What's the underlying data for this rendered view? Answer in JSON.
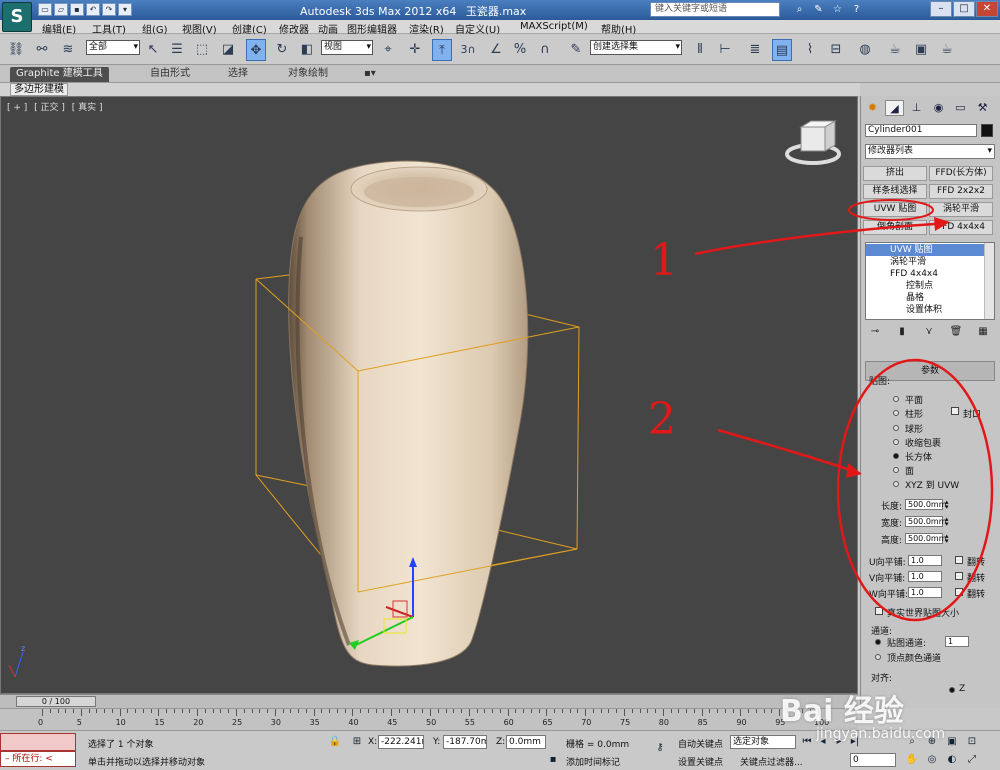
{
  "app": {
    "title": "Autodesk 3ds Max  2012 x64",
    "file": "玉瓷器.max",
    "logo": "S",
    "search_placeholder": "键入关键字或短语"
  },
  "menu": [
    "编辑(E)",
    "工具(T)",
    "组(G)",
    "视图(V)",
    "创建(C)",
    "修改器",
    "动画",
    "图形编辑器",
    "渲染(R)",
    "自定义(U)",
    "MAXScript(M)",
    "帮助(H)"
  ],
  "toolbar": {
    "selection_filter": "全部",
    "ref_coord": "视图",
    "snap_label": "3",
    "named_selection": "创建选择集"
  },
  "ribbon": {
    "tabs": [
      "Graphite 建模工具",
      "自由形式",
      "选择",
      "对象绘制"
    ],
    "sub_label": "多边形建模"
  },
  "viewport": {
    "labels": [
      "[ + ]",
      "[ 正交 ]",
      "[ 真实 ]"
    ]
  },
  "command_panel": {
    "object_name": "Cylinder001",
    "modifier_list": "修改器列表",
    "buttons": [
      [
        "挤出",
        "FFD(长方体)"
      ],
      [
        "样条线选择",
        "FFD 2x2x2"
      ],
      [
        "UVW 贴图",
        "涡轮平滑"
      ],
      [
        "倒角剖面",
        "FFD 4x4x4"
      ]
    ],
    "stack": [
      {
        "label": "UVW 贴图",
        "selected": true
      },
      {
        "label": "涡轮平滑",
        "selected": false
      },
      {
        "label": "FFD 4x4x4",
        "selected": false
      },
      {
        "label": "控制点",
        "sub": true
      },
      {
        "label": "晶格",
        "sub": true
      },
      {
        "label": "设置体积",
        "sub": true
      }
    ],
    "params_title": "参数",
    "mapping_label": "贴图:",
    "mapping_options": [
      {
        "label": "平面",
        "on": false
      },
      {
        "label": "柱形",
        "on": false
      },
      {
        "label": "球形",
        "on": false
      },
      {
        "label": "收缩包裹",
        "on": false
      },
      {
        "label": "长方体",
        "on": true
      },
      {
        "label": "面",
        "on": false
      },
      {
        "label": "XYZ 到 UVW",
        "on": false
      }
    ],
    "cap_label": "封口",
    "length_label": "长度:",
    "length": "500.0mm",
    "width_label": "宽度:",
    "width": "500.0mm",
    "height_label": "高度:",
    "height": "500.0mm",
    "u_tile_label": "U向平铺:",
    "u_tile": "1.0",
    "v_tile_label": "V向平铺:",
    "v_tile": "1.0",
    "w_tile_label": "W向平铺:",
    "w_tile": "1.0",
    "flip_label": "翻转",
    "real_world_label": "真实世界贴图大小",
    "channel_title": "通道:",
    "map_channel_label": "贴图通道:",
    "map_channel": "1",
    "vertex_color_label": "顶点颜色通道",
    "align_title": "对齐:",
    "align_z": "Z"
  },
  "timeline": {
    "slider": "0 / 100",
    "ticks": [
      "0",
      "5",
      "10",
      "15",
      "20",
      "25",
      "30",
      "35",
      "40",
      "45",
      "50",
      "55",
      "60",
      "65",
      "70",
      "75",
      "80",
      "85",
      "90",
      "95",
      "100"
    ]
  },
  "status": {
    "selected_text": "选择了 1 个对象",
    "prompt_text": "单击并拖动以选择并移动对象",
    "location_text": "所在行:",
    "x_label": "X:",
    "x": "-222.241m",
    "y_label": "Y:",
    "y": "-187.70m",
    "z_label": "Z:",
    "z": "0.0mm",
    "grid": "栅格 = 0.0mm",
    "auto_key": "自动关键点",
    "selected_obj": "选定对象",
    "set_key": "设置关键点",
    "key_filters": "关键点过滤器...",
    "add_time_tag": "添加时间标记",
    "frame": "0"
  },
  "annotations": {
    "one": "1",
    "two": "2"
  },
  "watermark": {
    "brand": "Bai 经验",
    "url": "jingyan.baidu.com"
  }
}
